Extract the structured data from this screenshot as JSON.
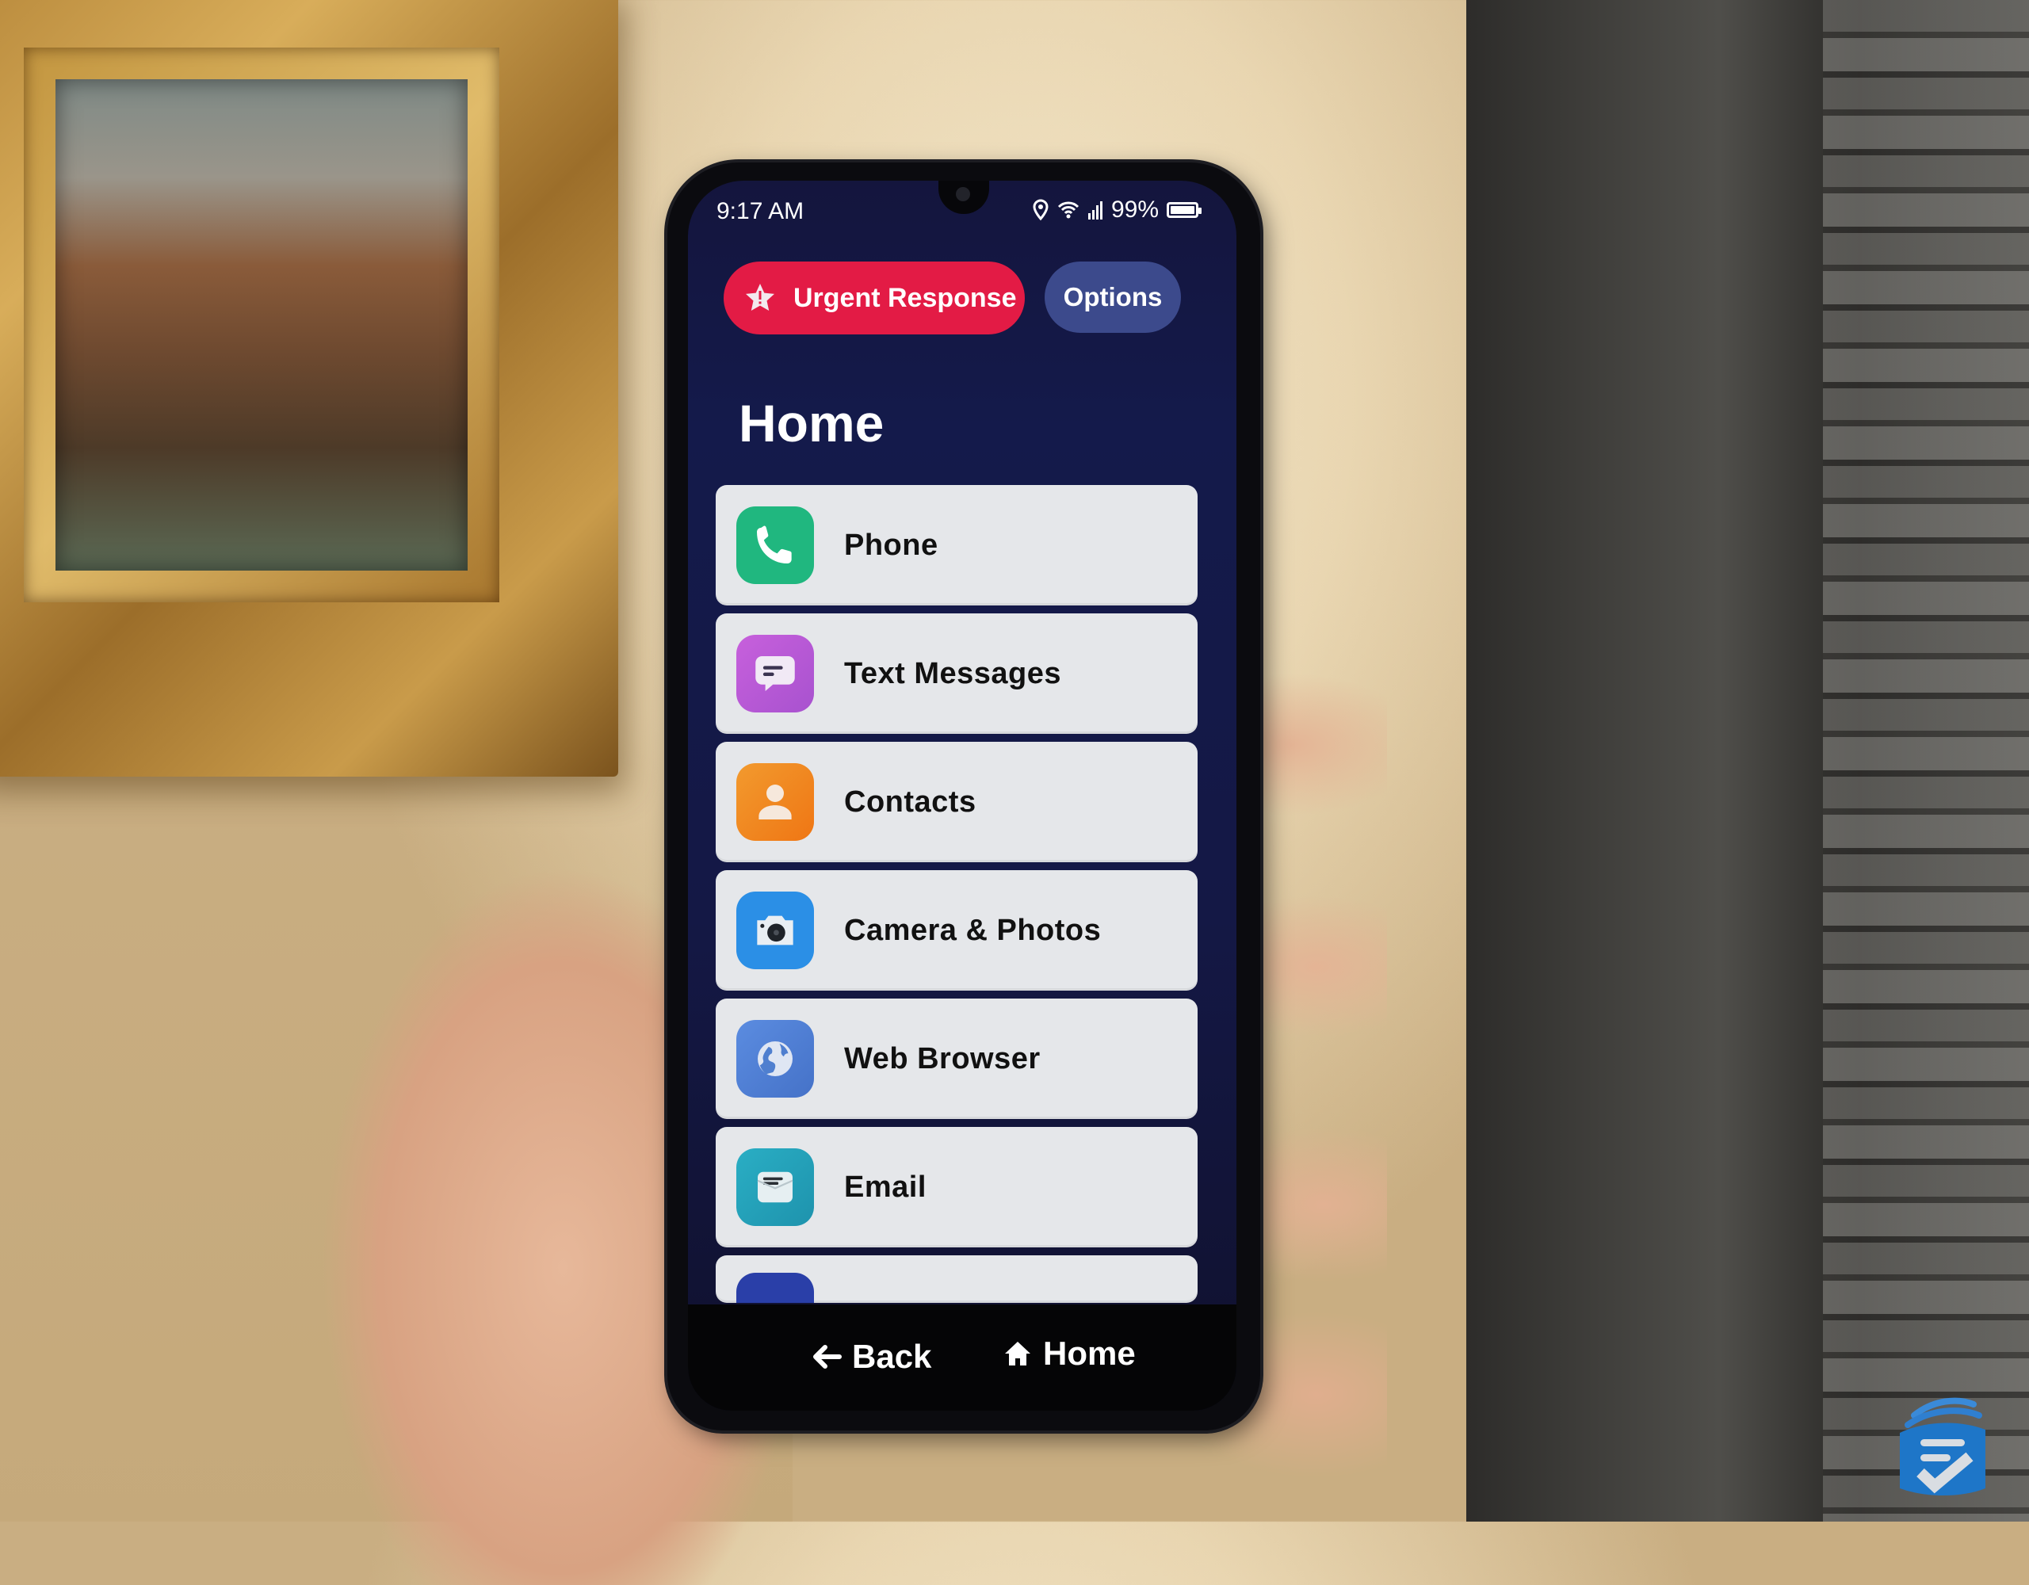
{
  "status_bar": {
    "time": "9:17 AM",
    "battery_percent": "99%",
    "battery_level": 0.99,
    "icons": [
      "location-icon",
      "wifi-icon",
      "signal-icon",
      "battery-icon"
    ]
  },
  "header": {
    "urgent_label": "Urgent Response",
    "urgent_icon": "star-alert-icon",
    "options_label": "Options"
  },
  "page": {
    "title": "Home"
  },
  "apps": [
    {
      "label": "Phone",
      "icon": "phone-icon",
      "color": "#20b77f"
    },
    {
      "label": "Text Messages",
      "icon": "message-icon",
      "color": "#b85ad6"
    },
    {
      "label": "Contacts",
      "icon": "contact-icon",
      "color": "#f07d1a"
    },
    {
      "label": "Camera & Photos",
      "icon": "camera-icon",
      "color": "#2b8fe6"
    },
    {
      "label": "Web Browser",
      "icon": "globe-icon",
      "color": "#4c7fd3"
    },
    {
      "label": "Email",
      "icon": "email-icon",
      "color": "#22a0b8"
    }
  ],
  "navbar": {
    "back_label": "Back",
    "home_label": "Home"
  },
  "colors": {
    "urgent": "#e31b45",
    "options": "#3c4a8c",
    "screen_bg": "#141a4b",
    "row_bg": "#e5e7ea"
  }
}
